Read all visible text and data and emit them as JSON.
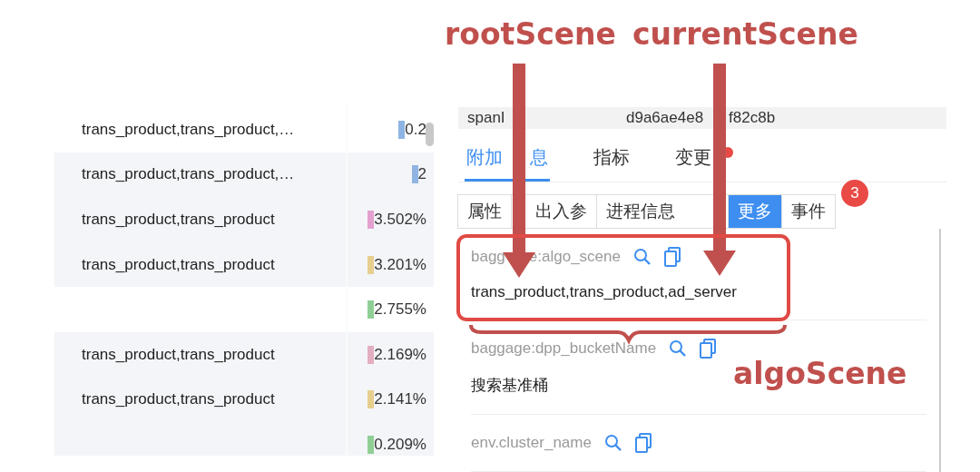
{
  "annotations": {
    "labels": [
      "rootScene",
      "currentScene",
      "algoScene"
    ]
  },
  "table": {
    "rows": [
      {
        "name": "trans_product,trans_product,…",
        "percent": "0.2",
        "color": "#8fb4e3",
        "shaded": false
      },
      {
        "name": "trans_product,trans_product,…",
        "percent": "2",
        "color": "#8fb4e3",
        "shaded": true
      },
      {
        "name": "trans_product,trans_product",
        "percent": "3.502%",
        "color": "#e3a0cf",
        "shaded": true
      },
      {
        "name": "trans_product,trans_product",
        "percent": "3.201%",
        "color": "#e6cf8e",
        "shaded": true
      },
      {
        "name": "",
        "percent": "2.755%",
        "color": "#8fcf95",
        "shaded": false
      },
      {
        "name": "trans_product,trans_product",
        "percent": "2.169%",
        "color": "#e3aec0",
        "shaded": true
      },
      {
        "name": "trans_product,trans_product",
        "percent": "2.141%",
        "color": "#e6cf8e",
        "shaded": true
      },
      {
        "name": "",
        "percent": "0.209%",
        "color": "#8fcf95",
        "shaded": true
      }
    ]
  },
  "detail": {
    "header": {
      "key": "spanI",
      "value_parts": [
        "d9a6ae4e8",
        "f82c8b"
      ]
    },
    "tabs": [
      {
        "label_parts": [
          "附加",
          "息"
        ],
        "selected": true,
        "dot": false
      },
      {
        "label_parts": [
          "指标"
        ],
        "selected": false,
        "dot": false
      },
      {
        "label_parts": [
          "变更"
        ],
        "selected": false,
        "dot": true
      }
    ],
    "subtabs": [
      {
        "label": "属性",
        "selected": false
      },
      {
        "label": "出入参",
        "selected": false
      },
      {
        "label": "进程信息",
        "selected": false
      },
      {
        "label": "更多",
        "selected": true
      },
      {
        "label": "事件",
        "selected": false
      }
    ],
    "subtab_badge": "3",
    "items": [
      {
        "key_parts": [
          "bagg",
          "e:algo_scene"
        ],
        "value": "trans_product,trans_product,ad_server"
      },
      {
        "key_parts": [
          "baggage:dpp_bucketName"
        ],
        "value": "搜索基准桶"
      },
      {
        "key_parts": [
          "env.cluster_name"
        ]
      }
    ]
  }
}
